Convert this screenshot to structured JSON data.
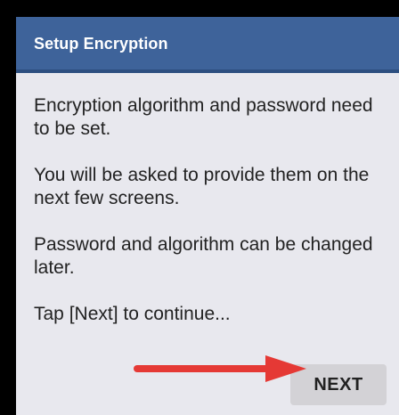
{
  "dialog": {
    "title": "Setup Encryption",
    "paragraphs": [
      "Encryption algorithm and password need to be set.",
      "You will be asked to provide them on the next few screens.",
      "Password and algorithm can be changed later.",
      "Tap [Next] to continue..."
    ],
    "next_label": "NEXT"
  },
  "annotation": {
    "arrow_color": "#e53935",
    "points_to": "next-button"
  },
  "colors": {
    "titlebar": "#3e639a",
    "dialog_bg": "#e8e8ee",
    "button_bg": "#d3d2d6"
  }
}
